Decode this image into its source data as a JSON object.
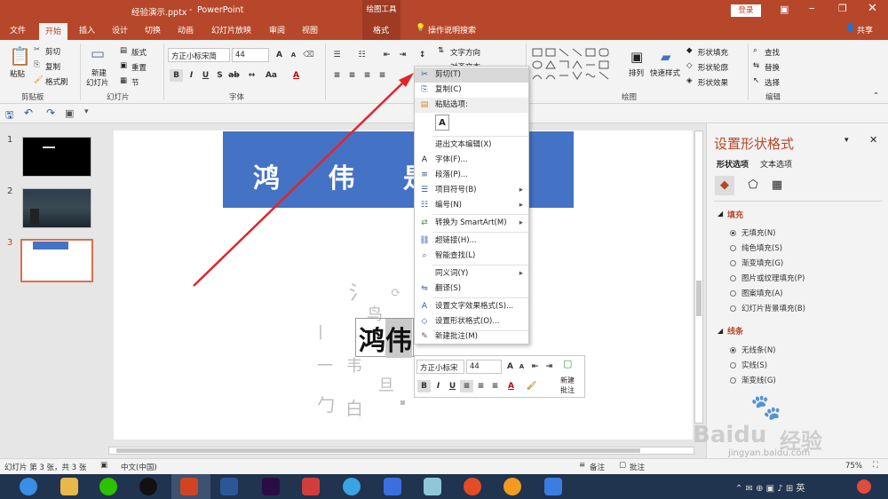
{
  "titlebar": {
    "file_name": "经验演示.pptx",
    "separator": "-",
    "app_name": "PowerPoint",
    "context_tool": "绘图工具",
    "login": "登录"
  },
  "tabs": [
    {
      "label": "文件",
      "active": false
    },
    {
      "label": "开始",
      "active": true
    },
    {
      "label": "插入",
      "active": false
    },
    {
      "label": "设计",
      "active": false
    },
    {
      "label": "切换",
      "active": false
    },
    {
      "label": "动画",
      "active": false
    },
    {
      "label": "幻灯片放映",
      "active": false
    },
    {
      "label": "审阅",
      "active": false
    },
    {
      "label": "视图",
      "active": false
    },
    {
      "label": "格式",
      "active": false
    }
  ],
  "tell_me": "操作说明搜索",
  "share": "共享",
  "ribbon": {
    "clipboard": {
      "paste": "粘贴",
      "cut": "剪切",
      "copy": "复制",
      "painter": "格式刷",
      "label": "剪贴板"
    },
    "slides": {
      "new_slide": "新建",
      "new_slide2": "幻灯片",
      "layout": "版式",
      "reset": "重置",
      "section": "节",
      "label": "幻灯片"
    },
    "font": {
      "name": "方正小标宋简",
      "size": "44",
      "bold": "B",
      "italic": "I",
      "underline": "U",
      "strike": "S",
      "label": "字体"
    },
    "paragraph": {
      "text_dir": "文字方向",
      "align_text": "对齐文本"
    },
    "drawing": {
      "arrange": "排列",
      "quick_styles": "快速样式",
      "fill": "形状填充",
      "outline": "形状轮廓",
      "effects": "形状效果",
      "label": "绘图"
    },
    "editing": {
      "find": "查找",
      "replace": "替换",
      "select": "选择",
      "label": "编辑"
    }
  },
  "slides": [
    {
      "num": "1"
    },
    {
      "num": "2"
    },
    {
      "num": "3"
    }
  ],
  "slide": {
    "banner_text": "鸿 伟 是 最",
    "selected_text": "鸿伟"
  },
  "context_menu": [
    {
      "icon": "✂",
      "label": "剪切(T)",
      "sub": false,
      "hl": true
    },
    {
      "icon": "⎘",
      "label": "复制(C)",
      "sub": false
    },
    {
      "icon": "📋",
      "label": "粘贴选项:",
      "sub": false,
      "header": true
    },
    {
      "icon": "",
      "label": "A",
      "sub": false,
      "paste": true
    },
    {
      "icon": "",
      "label": "退出文本编辑(X)",
      "sub": false
    },
    {
      "icon": "A",
      "label": "字体(F)...",
      "sub": false
    },
    {
      "icon": "≡",
      "label": "段落(P)...",
      "sub": false
    },
    {
      "icon": "☰",
      "label": "项目符号(B)",
      "sub": true
    },
    {
      "icon": "☷",
      "label": "编号(N)",
      "sub": true
    },
    {
      "icon": "⇄",
      "label": "转换为 SmartArt(M)",
      "sub": true
    },
    {
      "icon": "🔗",
      "label": "超链接(H)...",
      "sub": false
    },
    {
      "icon": "⌕",
      "label": "智能查找(L)",
      "sub": false
    },
    {
      "icon": "",
      "label": "同义词(Y)",
      "sub": true
    },
    {
      "icon": "文",
      "label": "翻译(S)",
      "sub": false
    },
    {
      "icon": "A",
      "label": "设置文字效果格式(S)...",
      "sub": false
    },
    {
      "icon": "◇",
      "label": "设置形状格式(O)...",
      "sub": false
    },
    {
      "icon": "✎",
      "label": "新建批注(M)",
      "sub": false
    }
  ],
  "mini_toolbar": {
    "font": "方正小标宋",
    "size": "44",
    "new_comment1": "新建",
    "new_comment2": "批注"
  },
  "pane": {
    "title": "设置形状格式",
    "tab1": "形状选项",
    "tab2": "文本选项",
    "fill_header": "填充",
    "fill": [
      {
        "label": "无填充(N)",
        "on": true
      },
      {
        "label": "纯色填充(S)",
        "on": false
      },
      {
        "label": "渐变填充(G)",
        "on": false
      },
      {
        "label": "图片或纹理填充(P)",
        "on": false
      },
      {
        "label": "图案填充(A)",
        "on": false
      },
      {
        "label": "幻灯片背景填充(B)",
        "on": false
      }
    ],
    "line_header": "线条",
    "line": [
      {
        "label": "无线条(N)",
        "on": true
      },
      {
        "label": "实线(S)",
        "on": false
      },
      {
        "label": "渐变线(G)",
        "on": false
      }
    ]
  },
  "status": {
    "slide_info": "幻灯片 第 3 张，共 3 张",
    "lang": "中文(中国)",
    "notes": "备注",
    "comments": "批注",
    "zoom": "75%"
  },
  "watermark": {
    "brand": "Baidu",
    "brand2": "经验",
    "url": "jingyan.baidu.com"
  },
  "colors": {
    "accent": "#b7472a",
    "banner": "#4472c4",
    "arrow": "#e0262a"
  }
}
